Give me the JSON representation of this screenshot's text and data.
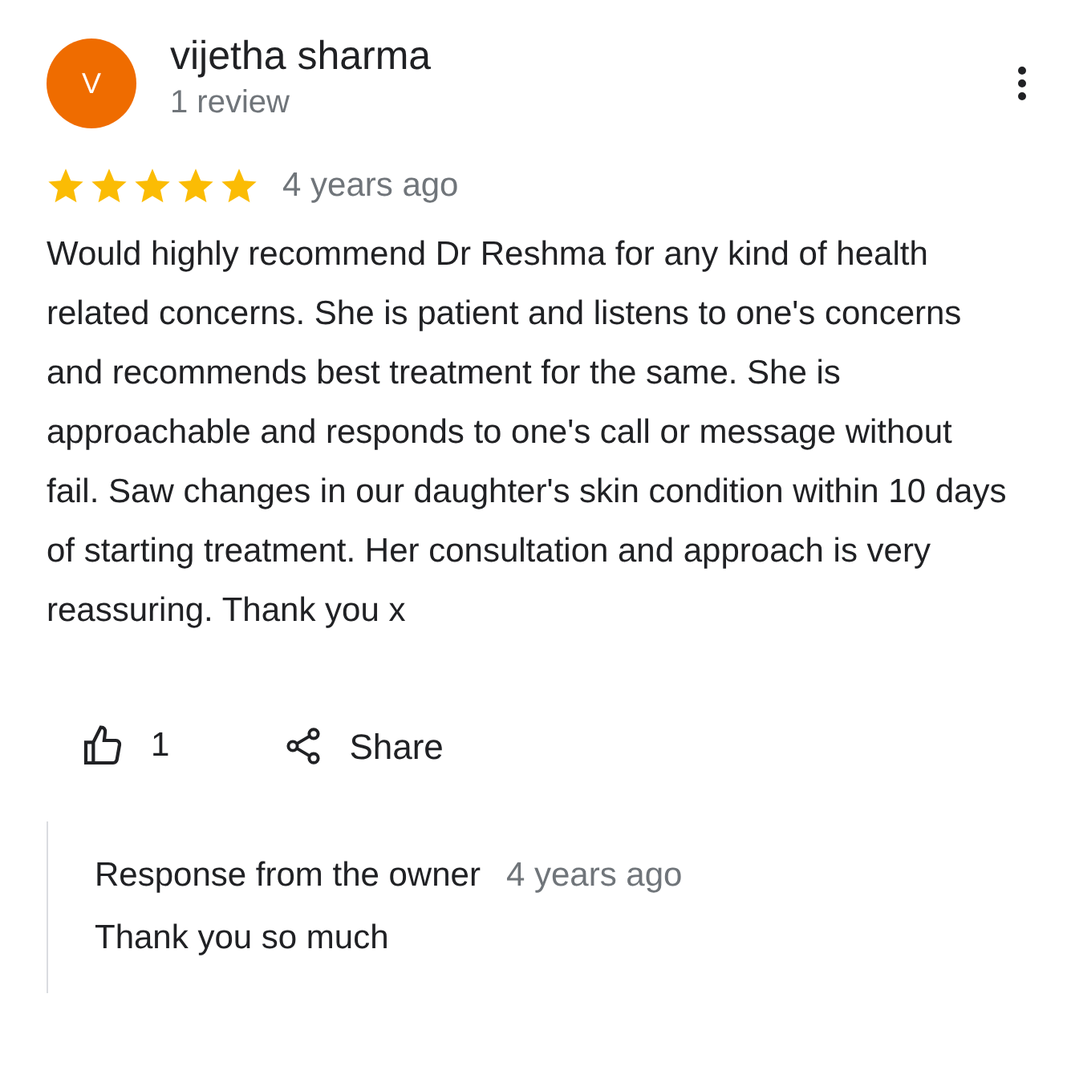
{
  "reviewer": {
    "initial": "V",
    "name": "vijetha sharma",
    "meta": "1 review"
  },
  "review": {
    "stars": 5,
    "time": "4 years ago",
    "text": "Would highly recommend Dr Reshma for any kind of health related concerns. She is patient and listens to one's concerns and recommends best treatment for the same. She is approachable and responds to one's call or message without fail. Saw changes in our daughter's skin condition within 10 days of starting treatment. Her consultation and approach is very reassuring. Thank you x"
  },
  "actions": {
    "like_count": "1",
    "share": "Share"
  },
  "owner_response": {
    "title": "Response from the owner",
    "time": "4 years ago",
    "text": "Thank you so much"
  }
}
